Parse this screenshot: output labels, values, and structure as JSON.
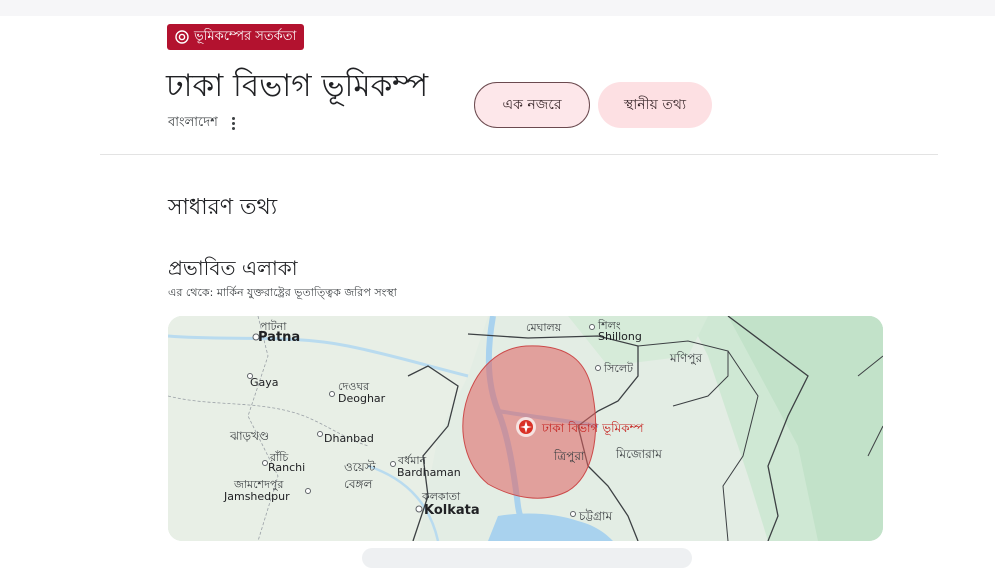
{
  "alert": {
    "label": "ভূমিকম্পের সতর্কতা",
    "icon": "target-icon",
    "color": "#b3122f"
  },
  "header": {
    "title": "ঢাকা বিভাগ ভূমিকম্প",
    "subtitle": "বাংলাদেশ",
    "tabs": [
      {
        "label": "এক নজরে",
        "selected": true
      },
      {
        "label": "স্থানীয় তথ্য",
        "selected": false
      }
    ]
  },
  "section": {
    "title": "সাধারণ তথ্য"
  },
  "affected_area": {
    "title": "প্রভাবিত এলাকা",
    "source": "এর থেকে: মার্কিন যুক্তরাষ্ট্রের ভূতাত্ত্বিক জরিপ সংস্থা"
  },
  "map": {
    "quake_label": "ঢাকা বিভাগ ভূমিকম্প",
    "labels": {
      "patna_bn": "পাটনা",
      "patna": "Patna",
      "gaya": "Gaya",
      "deoghar_bn": "দেওঘর",
      "deoghar": "Deoghar",
      "jharkhand": "ঝাড়খণ্ড",
      "dhanbad": "Dhanbad",
      "ranchi_bn": "রাঁচি",
      "ranchi": "Ranchi",
      "jamshedpur_bn": "জামশেদপুর",
      "jamshedpur": "Jamshedpur",
      "bardhaman_bn": "বর্ধমান",
      "bardhaman": "Bardhaman",
      "west_bengal_1": "ওয়েস্ট",
      "west_bengal_2": "বেঙ্গল",
      "kolkata_bn": "কলকাতা",
      "kolkata": "Kolkata",
      "meghalaya": "মেঘালয়",
      "shillong_bn": "শিলং",
      "shillong": "Shillong",
      "sylhet": "সিলেট",
      "manipur": "মণিপুর",
      "tripura": "ত্রিপুরা",
      "mizoram": "মিজোরাম",
      "chattogram": "চট্টগ্রাম"
    }
  }
}
